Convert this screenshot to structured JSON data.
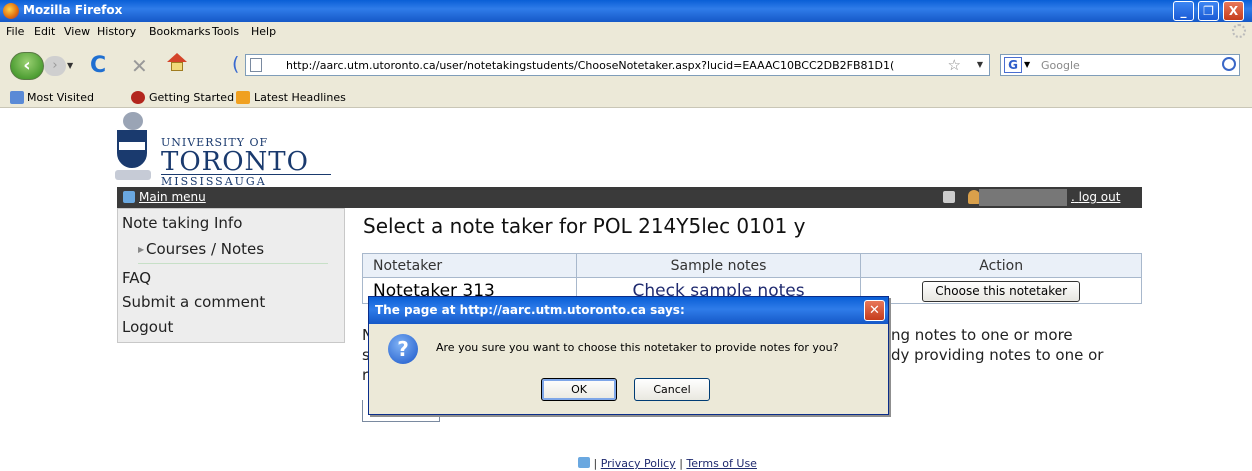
{
  "window": {
    "title": "Mozilla Firefox",
    "buttons": [
      "_",
      "❐",
      "X"
    ]
  },
  "menu": [
    "File",
    "Edit",
    "View",
    "History",
    "Bookmarks",
    "Tools",
    "Help"
  ],
  "nav": {
    "url": "http://aarc.utm.utoronto.ca/user/notetakingstudents/ChooseNotetaker.aspx?lucid=EAAAC10BCC2DB2FB81D1(",
    "search_placeholder": "Google",
    "search_engine_glyph": "G"
  },
  "bookmarks": [
    "Most Visited",
    "Getting Started",
    "Latest Headlines"
  ],
  "logo": {
    "line1": "UNIVERSITY OF",
    "line2": "TORONTO",
    "line3": "MISSISSAUGA"
  },
  "header": {
    "main_menu": "Main menu",
    "logout": "log out",
    "logout_prefix": "."
  },
  "sidebar": {
    "items": [
      "Note taking Info",
      "Courses / Notes",
      "FAQ",
      "Submit a comment",
      "Logout"
    ]
  },
  "page": {
    "title": "Select a note taker for POL 214Y5lec 0101 y",
    "table": {
      "headers": [
        "Notetaker",
        "Sample notes",
        "Action"
      ],
      "rows": [
        {
          "notetaker": "Notetaker 313",
          "sample": "Check sample notes",
          "action": "Choose this notetaker"
        }
      ]
    },
    "obscured_line1_left": "N",
    "obscured_line1_right": "ng notes to one or more",
    "obscured_line2_left": "s",
    "obscured_line2_right": "dy providing notes to one or",
    "obscured_line3_left": "r"
  },
  "dialog": {
    "title": "The page at http://aarc.utm.utoronto.ca says:",
    "message": "Are you sure you want to choose this notetaker to provide notes for you?",
    "ok": "OK",
    "cancel": "Cancel"
  },
  "footer": {
    "separator": "|",
    "privacy": "Privacy Policy",
    "terms": "Terms of Use"
  }
}
